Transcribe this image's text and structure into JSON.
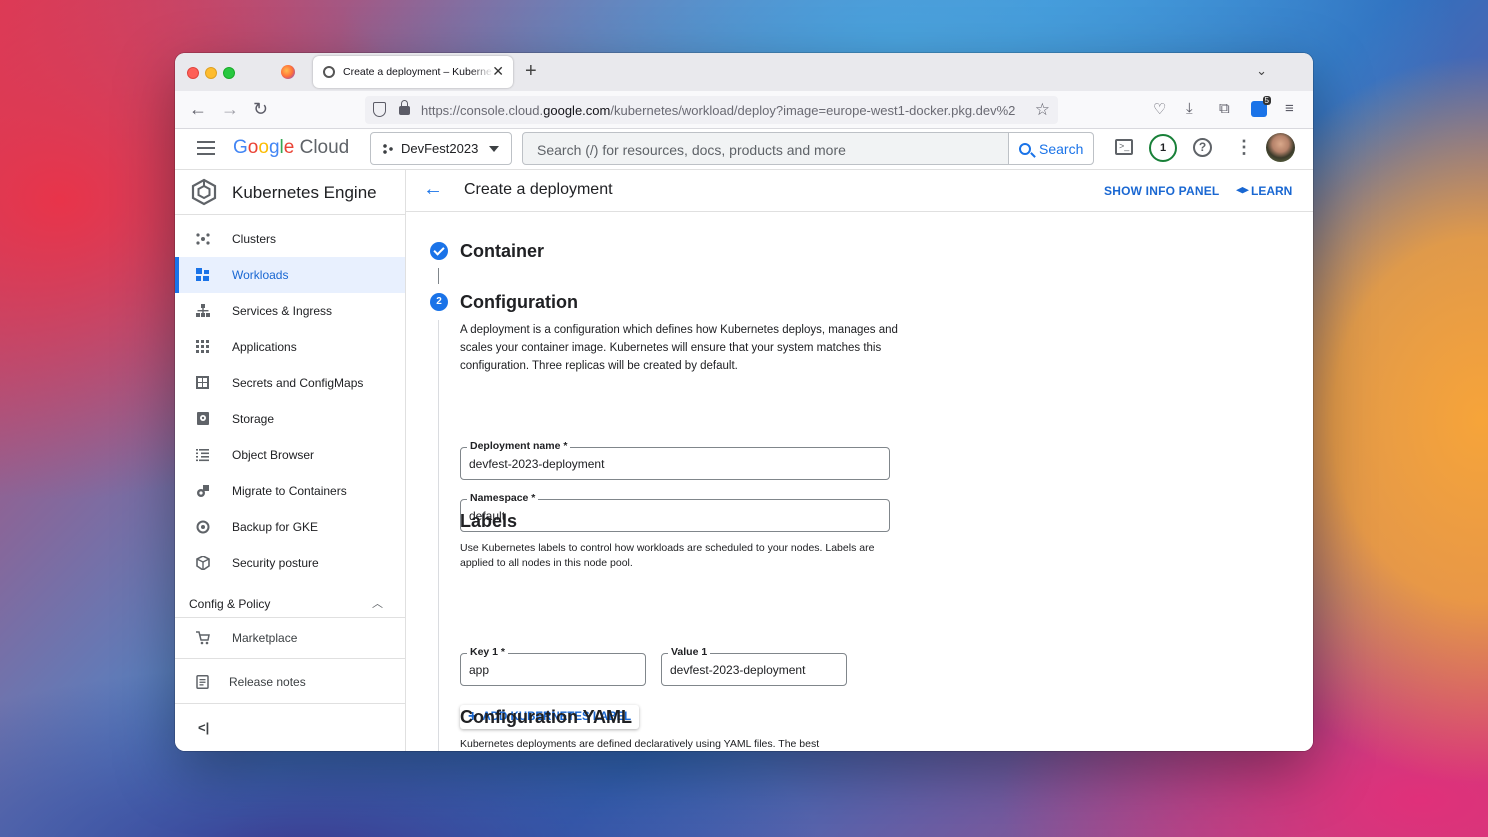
{
  "browser": {
    "tab_title": "Create a deployment – Kubernetes Engine",
    "url_prefix": "https://console.cloud.",
    "url_domain": "google.com",
    "url_path": "/kubernetes/workload/deploy?image=europe-west1-docker.pkg.dev%2",
    "extension_badge": "5"
  },
  "header": {
    "logo_google": [
      "G",
      "o",
      "o",
      "g",
      "l",
      "e"
    ],
    "logo_cloud": "Cloud",
    "project": "DevFest2023",
    "search_placeholder": "Search (/) for resources, docs, products and more",
    "search_button": "Search",
    "notification_count": "1"
  },
  "sidebar": {
    "title": "Kubernetes Engine",
    "items": [
      {
        "label": "Clusters",
        "icon": "clusters-icon"
      },
      {
        "label": "Workloads",
        "icon": "workloads-icon",
        "active": true
      },
      {
        "label": "Services & Ingress",
        "icon": "services-icon"
      },
      {
        "label": "Applications",
        "icon": "applications-icon"
      },
      {
        "label": "Secrets and ConfigMaps",
        "icon": "secrets-icon"
      },
      {
        "label": "Storage",
        "icon": "storage-icon"
      },
      {
        "label": "Object Browser",
        "icon": "object-browser-icon"
      },
      {
        "label": "Migrate to Containers",
        "icon": "migrate-icon"
      },
      {
        "label": "Backup for GKE",
        "icon": "backup-icon"
      },
      {
        "label": "Security posture",
        "icon": "security-icon"
      }
    ],
    "section_label": "Config & Policy",
    "marketplace": "Marketplace",
    "release_notes": "Release notes"
  },
  "main": {
    "title": "Create a deployment",
    "show_info_panel": "SHOW INFO PANEL",
    "learn": "LEARN",
    "step1_title": "Container",
    "step2_number": "2",
    "step2_title": "Configuration",
    "config_description": "A deployment is a configuration which defines how Kubernetes deploys, manages and scales your container image. Kubernetes will ensure that your system matches this configuration. Three replicas will be created by default.",
    "deployment_name_label": "Deployment name *",
    "deployment_name_value": "devfest-2023-deployment",
    "namespace_label": "Namespace *",
    "namespace_value": "default",
    "labels_title": "Labels",
    "labels_description": "Use Kubernetes labels to control how workloads are scheduled to your nodes. Labels are applied to all nodes in this node pool.",
    "key1_label": "Key 1 *",
    "key1_value": "app",
    "value1_label": "Value 1",
    "value1_value": "devfest-2023-deployment",
    "add_label_button": "ADD KUBERNETES LABEL",
    "yaml_title": "Configuration YAML",
    "yaml_description": "Kubernetes deployments are defined declaratively using YAML files. The best"
  }
}
